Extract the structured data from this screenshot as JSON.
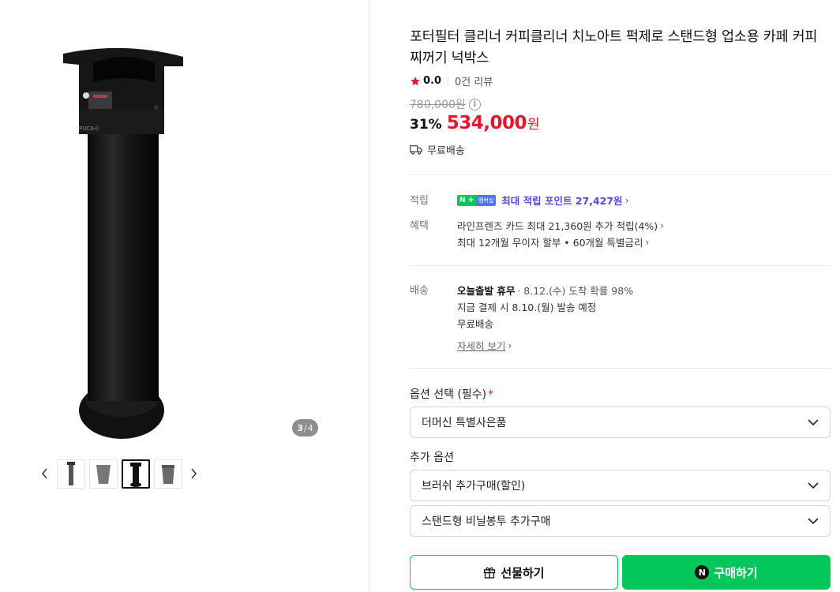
{
  "gallery": {
    "counter_current": "3",
    "counter_separator": "/",
    "counter_total": "4",
    "thumbnail_count": 4,
    "active_thumbnail": 3
  },
  "product": {
    "title": "포터필터 클리너 커피클리너 치노아트 퍽제로 스탠드형 업소용 카페 커피 찌꺼기 넉박스",
    "product_print_text": "PUCK-0",
    "rating": "0.0",
    "review_count": "0건 리뷰",
    "original_price": "780,000원",
    "discount": "31%",
    "sale_price": "534,000",
    "currency": "원",
    "shipping": "무료배송"
  },
  "points": {
    "label": "적립",
    "badge_n": "N",
    "badge_plus": "+",
    "badge_membership": "멤버십",
    "text": "최대 적립 포인트 27,427원"
  },
  "benefits": {
    "label": "혜택",
    "line1": "라인프렌즈 카드 최대 21,360원 추가 적립(4%)",
    "line2": "최대 12개월 무이자 할부 • 60개월 특별금리"
  },
  "delivery": {
    "label": "배송",
    "today": "오늘출발 휴무",
    "arrival": "· 8.12.(수) 도착 확률 98%",
    "dispatch": "지금 결제 시 8.10.(월) 발송 예정",
    "fee": "무료배송",
    "details_link": "자세히 보기"
  },
  "options": {
    "label": "옵션 선택 (필수)",
    "required_mark": "*",
    "selected": "더머신 특별사은품"
  },
  "extra_options": {
    "label": "추가 옵션",
    "option1": "브러쉬 추가구매(할인)",
    "option2": "스탠드형 비닐봉투 추가구매"
  },
  "actions": {
    "gift_label": "선물하기",
    "buy_label": "구매하기",
    "buy_badge": "N"
  },
  "colors": {
    "sale_red": "#e3162d",
    "naver_green": "#03c75a",
    "point_purple": "#5548e6"
  },
  "icons": [
    "star-icon",
    "info-icon",
    "truck-icon",
    "chevron-right-icon",
    "chevron-left-icon",
    "chevron-down-icon",
    "gift-icon"
  ]
}
